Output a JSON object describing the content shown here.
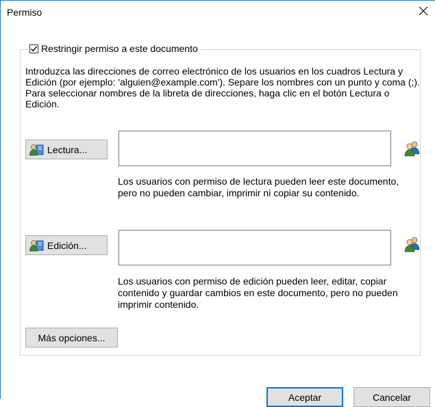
{
  "window": {
    "title": "Permiso",
    "close_glyph": "×"
  },
  "restrict": {
    "checked": true,
    "label": "Restringir permiso a este documento"
  },
  "instructions": "Introduzca las direcciones de correo electrónico de los usuarios en los cuadros Lectura y Edición (por ejemplo: 'alguien@example.com'). Separe los nombres con un punto y coma (;). Para seleccionar nombres de la libreta de direcciones, haga clic en el botón Lectura o Edición.",
  "read": {
    "button_label": "Lectura...",
    "value": "",
    "note": "Los usuarios con permiso de lectura pueden leer este documento, pero no pueden cambiar, imprimir ni copiar su contenido."
  },
  "edit": {
    "button_label": "Edición...",
    "value": "",
    "note": "Los usuarios con permiso de edición pueden leer, editar, copiar contenido y guardar cambios en este documento, pero no pueden imprimir contenido."
  },
  "more_options_label": "Más opciones...",
  "footer": {
    "accept_label": "Aceptar",
    "cancel_label": "Cancelar"
  },
  "colors": {
    "accent": "#0078d7",
    "window_border": "#1e74c9",
    "button_face": "#e1e1e1"
  }
}
